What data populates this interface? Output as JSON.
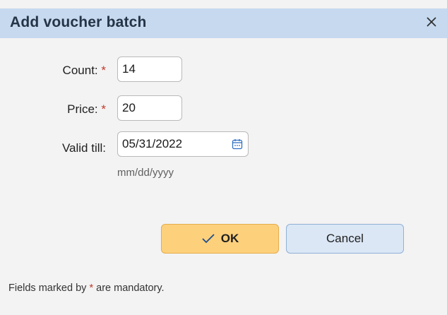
{
  "dialog": {
    "title": "Add voucher batch",
    "close_icon": "close-icon"
  },
  "form": {
    "count_label": "Count:",
    "count_value": "14",
    "price_label": "Price:",
    "price_value": "20",
    "valid_label": "Valid till:",
    "valid_value": "05/31/2022",
    "date_hint": "mm/dd/yyyy",
    "required_mark": "*",
    "calendar_icon": "calendar-icon"
  },
  "buttons": {
    "ok_label": "OK",
    "ok_icon": "check-icon",
    "cancel_label": "Cancel"
  },
  "footer": {
    "prefix": "Fields marked by",
    "mark": "*",
    "suffix": "are mandatory."
  },
  "colors": {
    "titlebar": "#c6d9ef",
    "ok_button": "#fdd07c",
    "cancel_button": "#dbe7f5",
    "required": "#c0392b"
  }
}
